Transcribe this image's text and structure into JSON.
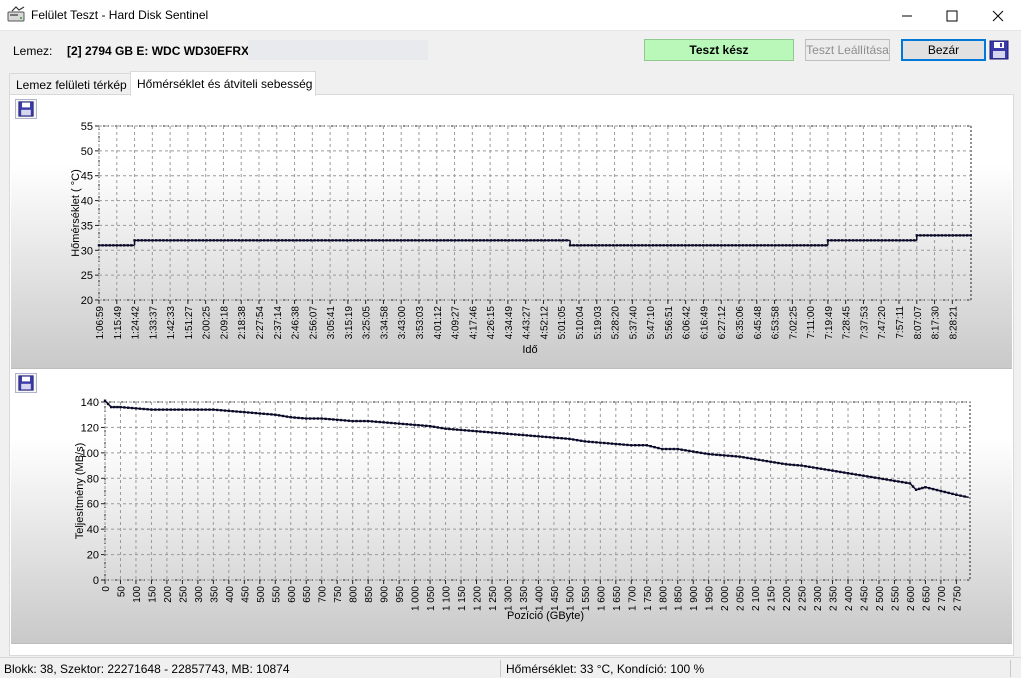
{
  "window": {
    "title": "Felület Teszt - Hard Disk Sentinel",
    "app_icon": "hdd-sentinel-icon",
    "controls": [
      "minimize-icon",
      "maximize-icon",
      "close-icon"
    ]
  },
  "toolbar": {
    "disk_label": "Lemez:",
    "disk_value": "[2] 2794 GB E: WDC WD30EFRX-",
    "status_text": "Teszt kész",
    "stop_button": "Teszt Leállítása",
    "close_button": "Bezár",
    "save_icon": "floppy-disk-icon"
  },
  "tabs": [
    {
      "label": "Lemez felületi térkép",
      "active": false
    },
    {
      "label": "Hőmérséklet és átviteli sebesség",
      "active": true
    }
  ],
  "charts": {
    "temperature": {
      "save_icon": "floppy-disk-icon"
    },
    "speed": {
      "save_icon": "floppy-disk-icon"
    }
  },
  "statusbar": {
    "left": "Blokk: 38, Szektor: 22271648 - 22857743, MB: 10874",
    "right": "Hőmérséklet: 33  °C,  Kondíció: 100 %"
  },
  "colors": {
    "status_ok": "#b9f8b9",
    "series": "#0a0a28",
    "accent": "#0078d7"
  },
  "chart_data": [
    {
      "type": "line",
      "title": "",
      "xlabel": "Idő",
      "ylabel": "Hőmérséklet ( °C)",
      "ylim": [
        20,
        55
      ],
      "yticks": [
        20,
        25,
        30,
        35,
        40,
        45,
        50,
        55
      ],
      "grid": true,
      "x_tick_labels": [
        "1:06:59",
        "1:15:49",
        "1:24:42",
        "1:33:37",
        "1:42:33",
        "1:51:27",
        "2:00:25",
        "2:09:18",
        "2:18:38",
        "2:27:54",
        "2:37:14",
        "2:46:38",
        "2:56:07",
        "3:05:41",
        "3:15:19",
        "3:25:05",
        "3:34:58",
        "3:43:00",
        "3:53:03",
        "4:01:12",
        "4:09:27",
        "4:17:46",
        "4:26:15",
        "4:34:49",
        "4:43:27",
        "4:52:12",
        "5:01:05",
        "5:10:04",
        "5:19:03",
        "5:28:20",
        "5:37:40",
        "5:47:10",
        "5:56:51",
        "6:06:42",
        "6:16:49",
        "6:27:12",
        "6:35:06",
        "6:45:48",
        "6:53:58",
        "7:02:25",
        "7:11:00",
        "7:19:49",
        "7:28:45",
        "7:37:53",
        "7:47:20",
        "7:57:11",
        "8:07:07",
        "8:17:30",
        "8:28:21"
      ],
      "segments": [
        {
          "from_tick": 0,
          "to_tick": 2,
          "value": 31
        },
        {
          "from_tick": 2,
          "to_tick": 26.5,
          "value": 32
        },
        {
          "from_tick": 26.5,
          "to_tick": 41,
          "value": 31
        },
        {
          "from_tick": 41,
          "to_tick": 46,
          "value": 32
        },
        {
          "from_tick": 46,
          "to_tick": 50,
          "value": 33
        }
      ]
    },
    {
      "type": "line",
      "title": "",
      "xlabel": "Pozíció (GByte)",
      "ylabel": "Teljesítmény (MB/s)",
      "xlim": [
        0,
        2794
      ],
      "ylim": [
        0,
        140
      ],
      "yticks": [
        0,
        20,
        40,
        60,
        80,
        100,
        120,
        140
      ],
      "x_tick_values": [
        0,
        50,
        100,
        150,
        200,
        250,
        300,
        350,
        400,
        450,
        500,
        550,
        600,
        650,
        700,
        750,
        800,
        850,
        900,
        950,
        1000,
        1050,
        1100,
        1150,
        1200,
        1250,
        1300,
        1350,
        1400,
        1450,
        1500,
        1550,
        1600,
        1650,
        1700,
        1750,
        1800,
        1850,
        1900,
        1950,
        2000,
        2050,
        2100,
        2150,
        2200,
        2250,
        2300,
        2350,
        2400,
        2450,
        2500,
        2550,
        2600,
        2650,
        2700,
        2750
      ],
      "x_tick_labels": [
        "0",
        "50",
        "100",
        "150",
        "200",
        "250",
        "300",
        "350",
        "400",
        "450",
        "500",
        "550",
        "600",
        "650",
        "700",
        "750",
        "800",
        "850",
        "900",
        "950",
        "1 000",
        "1 050",
        "1 100",
        "1 150",
        "1 200",
        "1 250",
        "1 300",
        "1 350",
        "1 400",
        "1 450",
        "1 500",
        "1 550",
        "1 600",
        "1 650",
        "1 700",
        "1 750",
        "1 800",
        "1 850",
        "1 900",
        "1 950",
        "2 000",
        "2 050",
        "2 100",
        "2 150",
        "2 200",
        "2 250",
        "2 300",
        "2 350",
        "2 400",
        "2 450",
        "2 500",
        "2 550",
        "2 600",
        "2 650",
        "2 700",
        "2 750"
      ],
      "grid": true,
      "series": [
        {
          "x": [
            0,
            20,
            50,
            100,
            150,
            200,
            250,
            300,
            350,
            400,
            450,
            500,
            550,
            600,
            650,
            700,
            750,
            800,
            850,
            900,
            950,
            1000,
            1050,
            1100,
            1150,
            1200,
            1250,
            1300,
            1350,
            1400,
            1450,
            1500,
            1550,
            1600,
            1650,
            1700,
            1750,
            1800,
            1850,
            1900,
            1950,
            2000,
            2050,
            2100,
            2150,
            2200,
            2250,
            2300,
            2350,
            2400,
            2450,
            2500,
            2550,
            2600,
            2620,
            2650,
            2700,
            2750,
            2790
          ],
          "y": [
            141,
            136,
            136,
            135,
            134,
            134,
            134,
            134,
            134,
            133,
            132,
            131,
            130,
            128,
            127,
            127,
            126,
            125,
            125,
            124,
            123,
            122,
            121,
            119,
            118,
            117,
            116,
            115,
            114,
            113,
            112,
            111,
            109,
            108,
            107,
            106,
            106,
            103,
            103,
            101,
            99,
            98,
            97,
            95,
            93,
            91,
            90,
            88,
            86,
            84,
            82,
            80,
            78,
            76,
            71,
            73,
            70,
            67,
            65
          ]
        }
      ]
    }
  ]
}
